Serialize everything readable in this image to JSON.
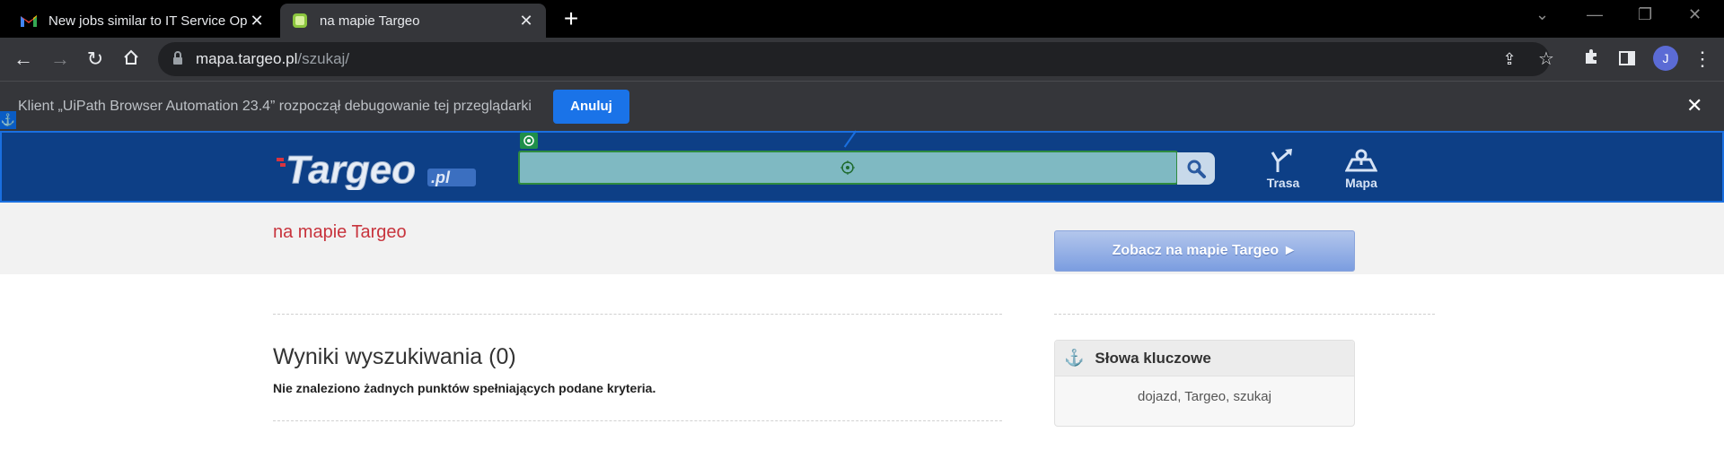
{
  "browser": {
    "tabs": [
      {
        "title": "New jobs similar to IT Service Op",
        "favicon": "gmail-icon",
        "active": false
      },
      {
        "title": "na mapie Targeo",
        "favicon": "targeo-icon",
        "active": true
      }
    ],
    "url_host": "mapa.targeo.pl",
    "url_path": "/szukaj/",
    "profile_initial": "J"
  },
  "debug_bar": {
    "message": "Klient „UiPath Browser Automation 23.4” rozpoczął debugowanie tej przeglądarki",
    "cancel_label": "Anuluj",
    "accent": "#1a73e8"
  },
  "site": {
    "logo_text": "Targeo",
    "logo_suffix": ".pl",
    "search_value": "",
    "nav": [
      {
        "label": "Trasa",
        "icon": "route-icon"
      },
      {
        "label": "Mapa",
        "icon": "map-icon"
      }
    ],
    "header_color": "#0d3f86"
  },
  "page": {
    "title": "na mapie Targeo",
    "map_button": "Zobacz na mapie Targeo ►",
    "results_title": "Wyniki wyszukiwania (0)",
    "results_message": "Nie znaleziono żadnych punktów spełniających podane kryteria.",
    "keywords_title": "Słowa kluczowe",
    "keywords": "dojazd, Targeo, szukaj"
  }
}
